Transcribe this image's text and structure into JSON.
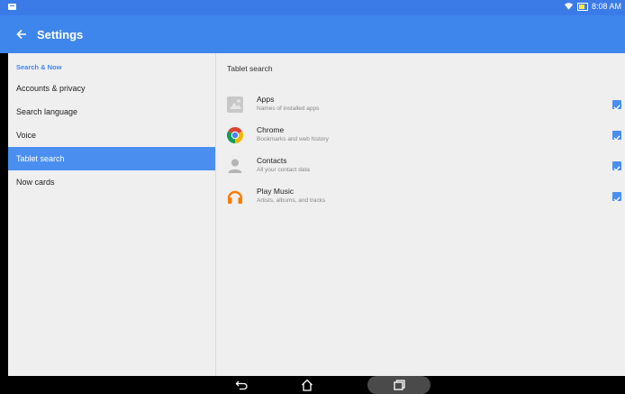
{
  "status_bar": {
    "time": "8:08 AM"
  },
  "app_bar": {
    "title": "Settings"
  },
  "sidebar": {
    "section_header": "Search & Now",
    "items": [
      {
        "label": "Accounts & privacy",
        "selected": false
      },
      {
        "label": "Search language",
        "selected": false
      },
      {
        "label": "Voice",
        "selected": false
      },
      {
        "label": "Tablet search",
        "selected": true
      },
      {
        "label": "Now cards",
        "selected": false
      }
    ]
  },
  "main": {
    "title": "Tablet search",
    "items": [
      {
        "title": "Apps",
        "subtitle": "Names of installed apps",
        "icon": "apps-icon",
        "checked": true
      },
      {
        "title": "Chrome",
        "subtitle": "Bookmarks and web history",
        "icon": "chrome-icon",
        "checked": true
      },
      {
        "title": "Contacts",
        "subtitle": "All your contact data",
        "icon": "contacts-icon",
        "checked": true
      },
      {
        "title": "Play Music",
        "subtitle": "Artists, albums, and tracks",
        "icon": "headphones-icon",
        "checked": true
      }
    ]
  },
  "colors": {
    "accent": "#4a8ff0",
    "app_bar": "#3f86ec",
    "status_bar": "#3b7be8",
    "background": "#efefef"
  }
}
